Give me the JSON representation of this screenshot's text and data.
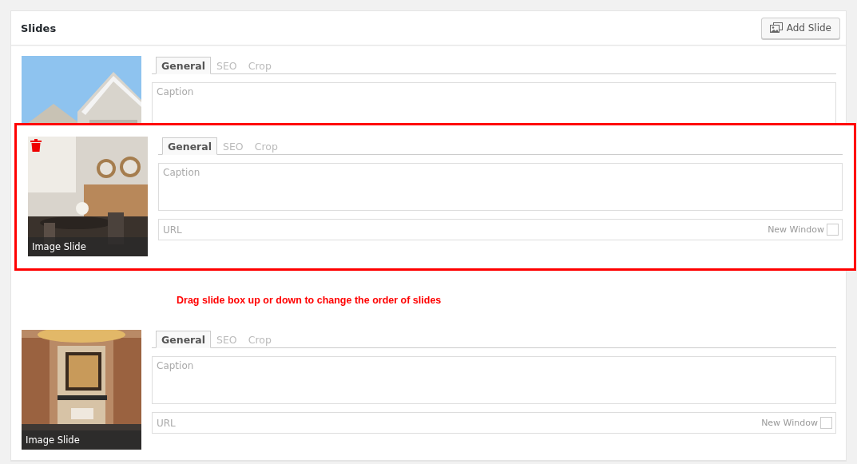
{
  "panel": {
    "title": "Slides",
    "add_button": "Add Slide"
  },
  "slides": [
    {
      "dragging": false,
      "tabs": [
        {
          "label": "General",
          "selected": true
        },
        {
          "label": "SEO",
          "selected": false
        },
        {
          "label": "Crop",
          "selected": false
        }
      ],
      "caption": {
        "placeholder": "Caption"
      }
    },
    {
      "dragging": true,
      "tabs": [
        {
          "label": "General",
          "selected": true
        },
        {
          "label": "SEO",
          "selected": false
        },
        {
          "label": "Crop",
          "selected": false
        }
      ],
      "caption": {
        "placeholder": "Caption"
      },
      "url": {
        "placeholder": "URL"
      },
      "new_window": {
        "label": "New Window",
        "checked": false
      },
      "image_label": "Image Slide"
    },
    {
      "dragging": false,
      "tabs": [
        {
          "label": "General",
          "selected": true
        },
        {
          "label": "SEO",
          "selected": false
        },
        {
          "label": "Crop",
          "selected": false
        }
      ],
      "caption": {
        "placeholder": "Caption"
      },
      "url": {
        "placeholder": "URL"
      },
      "new_window": {
        "label": "New Window",
        "checked": false
      },
      "image_label": "Image Slide"
    }
  ],
  "hint": "Drag slide box up or down to change the order of slides"
}
